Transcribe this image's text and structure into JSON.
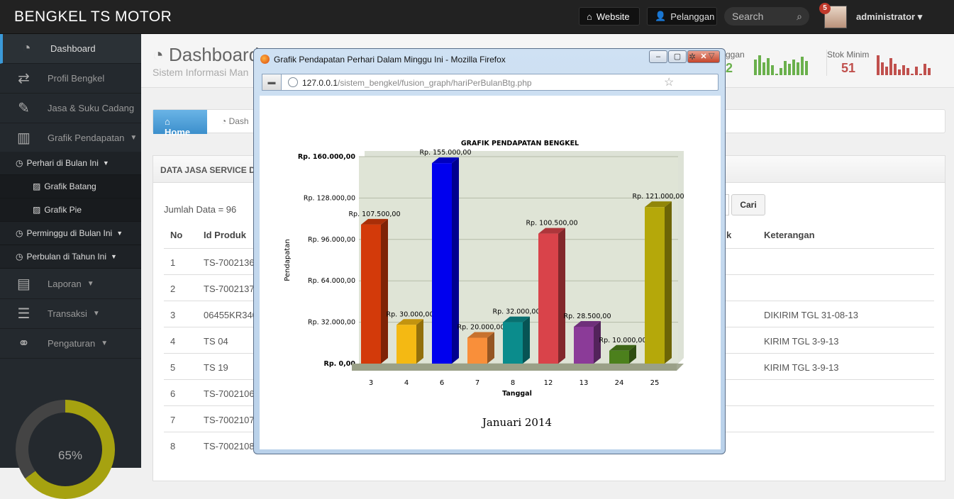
{
  "brand": "BENGKEL TS MOTOR",
  "topbar": {
    "website_label": "Website",
    "pelanggan_label": "Pelanggan",
    "search_placeholder": "Search",
    "badge_count": "5",
    "user": "administrator"
  },
  "sidebar": {
    "items": [
      {
        "label": "Dashboard",
        "icon": "dashboard-icon"
      },
      {
        "label": "Profil Bengkel",
        "icon": "retweet-icon"
      },
      {
        "label": "Jasa & Suku Cadang",
        "icon": "edit-icon"
      },
      {
        "label": "Grafik Pendapatan",
        "icon": "bar-chart-icon"
      },
      {
        "label": "Laporan",
        "icon": "book-icon"
      },
      {
        "label": "Transaksi",
        "icon": "server-icon"
      },
      {
        "label": "Pengaturan",
        "icon": "link-icon"
      }
    ],
    "sub": {
      "perhari": "Perhari di Bulan Ini",
      "grafik_batang": "Grafik Batang",
      "grafik_pie": "Grafik Pie",
      "perminggu": "Perminggu di Bulan Ini",
      "perbulan": "Perbulan di Tahun Ini"
    },
    "gauge_label": "65%",
    "gauge_value": 65
  },
  "header": {
    "title": "Dashboard",
    "subtitle": "Sistem Informasi Man",
    "stat_pelanggan_label": "ggan",
    "stat_pelanggan_value": "2",
    "stat_stok_label": "Stok Minim",
    "stat_stok_value": "51",
    "stat_green": "#6ab04c",
    "stat_red": "#c0504d"
  },
  "breadcrumb": {
    "home": "Home",
    "current": "Dash"
  },
  "panel": {
    "title": "DATA JASA SERVICE DAN",
    "jumlah": "Jumlah Data = 96",
    "cari": "Cari",
    "headers": {
      "no": "No",
      "id": "Id Produk",
      "k": "k",
      "ket": "Keterangan"
    },
    "rows": [
      {
        "no": "1",
        "id": "TS-7002136",
        "ket": ""
      },
      {
        "no": "2",
        "id": "TS-7002137",
        "ket": ""
      },
      {
        "no": "3",
        "id": "06455KR340",
        "ket": "DIKIRIM TGL 31-08-13"
      },
      {
        "no": "4",
        "id": "TS 04",
        "ket": "KIRIM TGL 3-9-13"
      },
      {
        "no": "5",
        "id": "TS 19",
        "ket": "KIRIM TGL 3-9-13"
      },
      {
        "no": "6",
        "id": "TS-7002106",
        "ket": ""
      },
      {
        "no": "7",
        "id": "TS-7002107",
        "ket": ""
      },
      {
        "no": "8",
        "id": "TS-7002108",
        "ket": ""
      }
    ]
  },
  "popup": {
    "title": "Grafik Pendapatan Perhari Dalam Minggu Ini - Mozilla Firefox",
    "url_host": "127.0.0.1",
    "url_path": "/sistem_bengkel/fusion_graph/hariPerBulanBtg.php",
    "caption": "Januari 2014"
  },
  "chart_data": {
    "type": "bar",
    "title": "GRAFIK PENDAPATAN BENGKEL",
    "xlabel": "Tanggal",
    "ylabel": "Pendapatan",
    "ylim": [
      0,
      160000
    ],
    "y_ticks": [
      "Rp. 0,00",
      "Rp. 32.000,00",
      "Rp. 64.000,00",
      "Rp. 96.000,00",
      "Rp. 128.000,00",
      "Rp. 160.000,00"
    ],
    "categories": [
      "3",
      "4",
      "6",
      "7",
      "8",
      "12",
      "13",
      "24",
      "25"
    ],
    "values": [
      107500,
      30000,
      155000,
      20000,
      32000,
      100500,
      28500,
      10000,
      121000
    ],
    "labels": [
      "Rp. 107.500,00",
      "Rp. 30.000,00",
      "Rp. 155.000,00",
      "Rp. 20.000,00",
      "Rp. 32.000,00",
      "Rp. 100.500,00",
      "Rp. 28.500,00",
      "Rp. 10.000,00",
      "Rp. 121.000,00"
    ],
    "colors": [
      "#d33a0a",
      "#f4b913",
      "#0000ee",
      "#f98f3a",
      "#0b8c8c",
      "#d9434a",
      "#8b3b98",
      "#4c801c",
      "#b5a80a"
    ],
    "grid": true,
    "legend": "none"
  }
}
